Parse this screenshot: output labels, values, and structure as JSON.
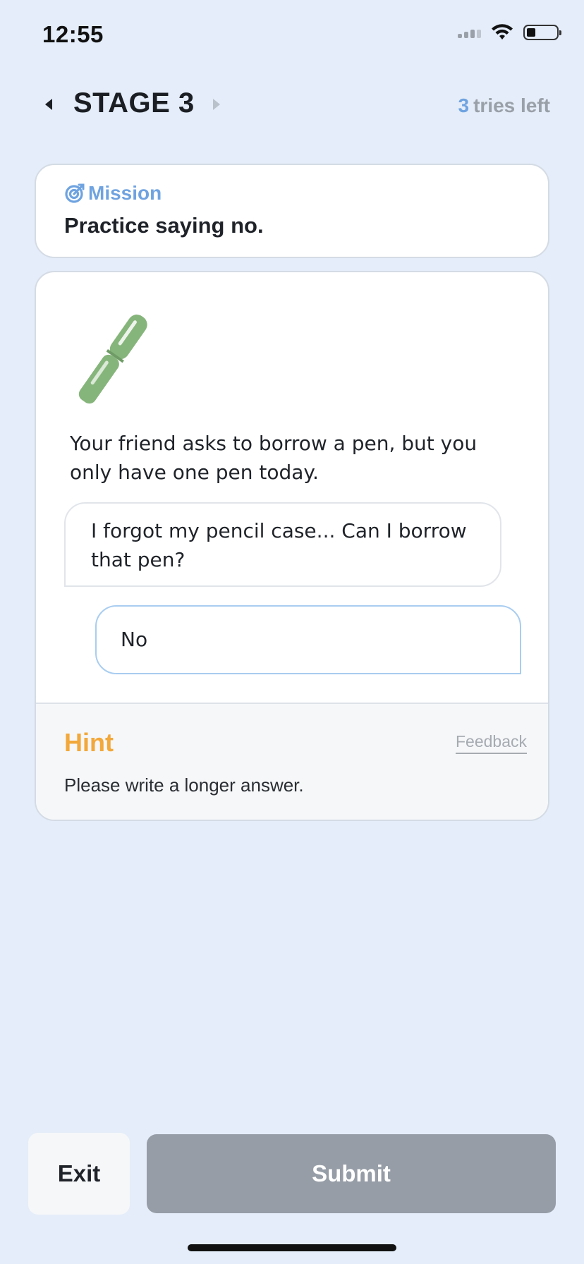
{
  "status_bar": {
    "time": "12:55"
  },
  "header": {
    "stage_title": "STAGE 3",
    "tries_count": "3",
    "tries_label": "tries left"
  },
  "mission": {
    "label": "Mission",
    "text": "Practice saying no."
  },
  "scenario": {
    "illustration": "pen-icon",
    "description": "Your friend asks to borrow a pen, but you only have one pen today.",
    "friend_message": "I forgot my pencil case... Can I borrow that pen?",
    "answer_value": "No"
  },
  "hint": {
    "title": "Hint",
    "feedback_label": "Feedback",
    "text": "Please write a longer answer."
  },
  "actions": {
    "exit_label": "Exit",
    "submit_label": "Submit"
  },
  "colors": {
    "accent": "#6fa3e0",
    "hint": "#f2a83a",
    "background": "#e4edf9",
    "submit_disabled": "#969da6"
  }
}
